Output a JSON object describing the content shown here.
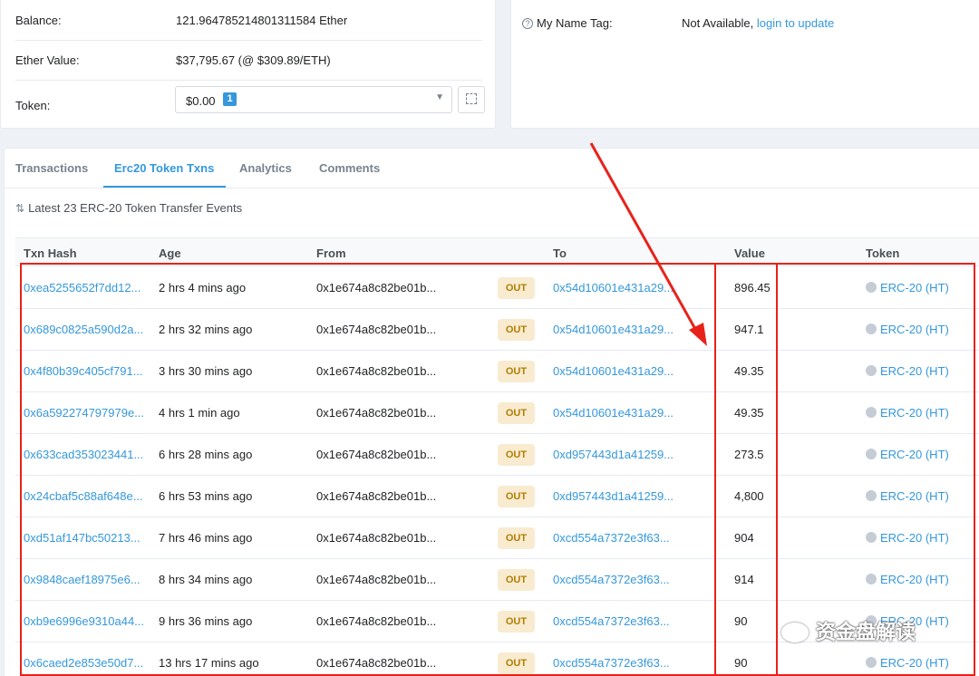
{
  "overview": {
    "balance_label": "Balance:",
    "balance_value": "121.964785214801311584 Ether",
    "ether_value_label": "Ether Value:",
    "ether_value": "$37,795.67 (@ $309.89/ETH)",
    "token_label": "Token:",
    "token_select_value": "$0.00",
    "token_count": "1"
  },
  "more_info": {
    "name_tag_label": "My Name Tag:",
    "name_tag_value": "Not Available,",
    "name_tag_link": "login to update"
  },
  "tabs": [
    "Transactions",
    "Erc20 Token Txns",
    "Analytics",
    "Comments"
  ],
  "active_tab": "Erc20 Token Txns",
  "events_title": "Latest 23 ERC-20 Token Transfer Events",
  "table": {
    "headers": [
      "Txn Hash",
      "Age",
      "From",
      "",
      "To",
      "Value",
      "Token"
    ],
    "rows": [
      {
        "hash": "0xea5255652f7dd12...",
        "age": "2 hrs 4 mins ago",
        "from": "0x1e674a8c82be01b...",
        "dir": "OUT",
        "to": "0x54d10601e431a29...",
        "value": "896.45",
        "token": "ERC-20 (HT)"
      },
      {
        "hash": "0x689c0825a590d2a...",
        "age": "2 hrs 32 mins ago",
        "from": "0x1e674a8c82be01b...",
        "dir": "OUT",
        "to": "0x54d10601e431a29...",
        "value": "947.1",
        "token": "ERC-20 (HT)"
      },
      {
        "hash": "0x4f80b39c405cf791...",
        "age": "3 hrs 30 mins ago",
        "from": "0x1e674a8c82be01b...",
        "dir": "OUT",
        "to": "0x54d10601e431a29...",
        "value": "49.35",
        "token": "ERC-20 (HT)"
      },
      {
        "hash": "0x6a592274797979e...",
        "age": "4 hrs 1 min ago",
        "from": "0x1e674a8c82be01b...",
        "dir": "OUT",
        "to": "0x54d10601e431a29...",
        "value": "49.35",
        "token": "ERC-20 (HT)"
      },
      {
        "hash": "0x633cad353023441...",
        "age": "6 hrs 28 mins ago",
        "from": "0x1e674a8c82be01b...",
        "dir": "OUT",
        "to": "0xd957443d1a41259...",
        "value": "273.5",
        "token": "ERC-20 (HT)"
      },
      {
        "hash": "0x24cbaf5c88af648e...",
        "age": "6 hrs 53 mins ago",
        "from": "0x1e674a8c82be01b...",
        "dir": "OUT",
        "to": "0xd957443d1a41259...",
        "value": "4,800",
        "token": "ERC-20 (HT)"
      },
      {
        "hash": "0xd51af147bc50213...",
        "age": "7 hrs 46 mins ago",
        "from": "0x1e674a8c82be01b...",
        "dir": "OUT",
        "to": "0xcd554a7372e3f63...",
        "value": "904",
        "token": "ERC-20 (HT)"
      },
      {
        "hash": "0x9848caef18975e6...",
        "age": "8 hrs 34 mins ago",
        "from": "0x1e674a8c82be01b...",
        "dir": "OUT",
        "to": "0xcd554a7372e3f63...",
        "value": "914",
        "token": "ERC-20 (HT)"
      },
      {
        "hash": "0xb9e6996e9310a44...",
        "age": "9 hrs 36 mins ago",
        "from": "0x1e674a8c82be01b...",
        "dir": "OUT",
        "to": "0xcd554a7372e3f63...",
        "value": "90",
        "token": "ERC-20 (HT)"
      },
      {
        "hash": "0x6caed2e853e50d7...",
        "age": "13 hrs 17 mins ago",
        "from": "0x1e674a8c82be01b...",
        "dir": "OUT",
        "to": "0xcd554a7372e3f63...",
        "value": "90",
        "token": "ERC-20 (HT)"
      }
    ]
  },
  "watermark": "资金盘解读",
  "colors": {
    "link": "#3498db",
    "out_badge_bg": "#f8ebd0",
    "out_badge_text": "#b47d00",
    "annotation_red": "#e8221a"
  }
}
